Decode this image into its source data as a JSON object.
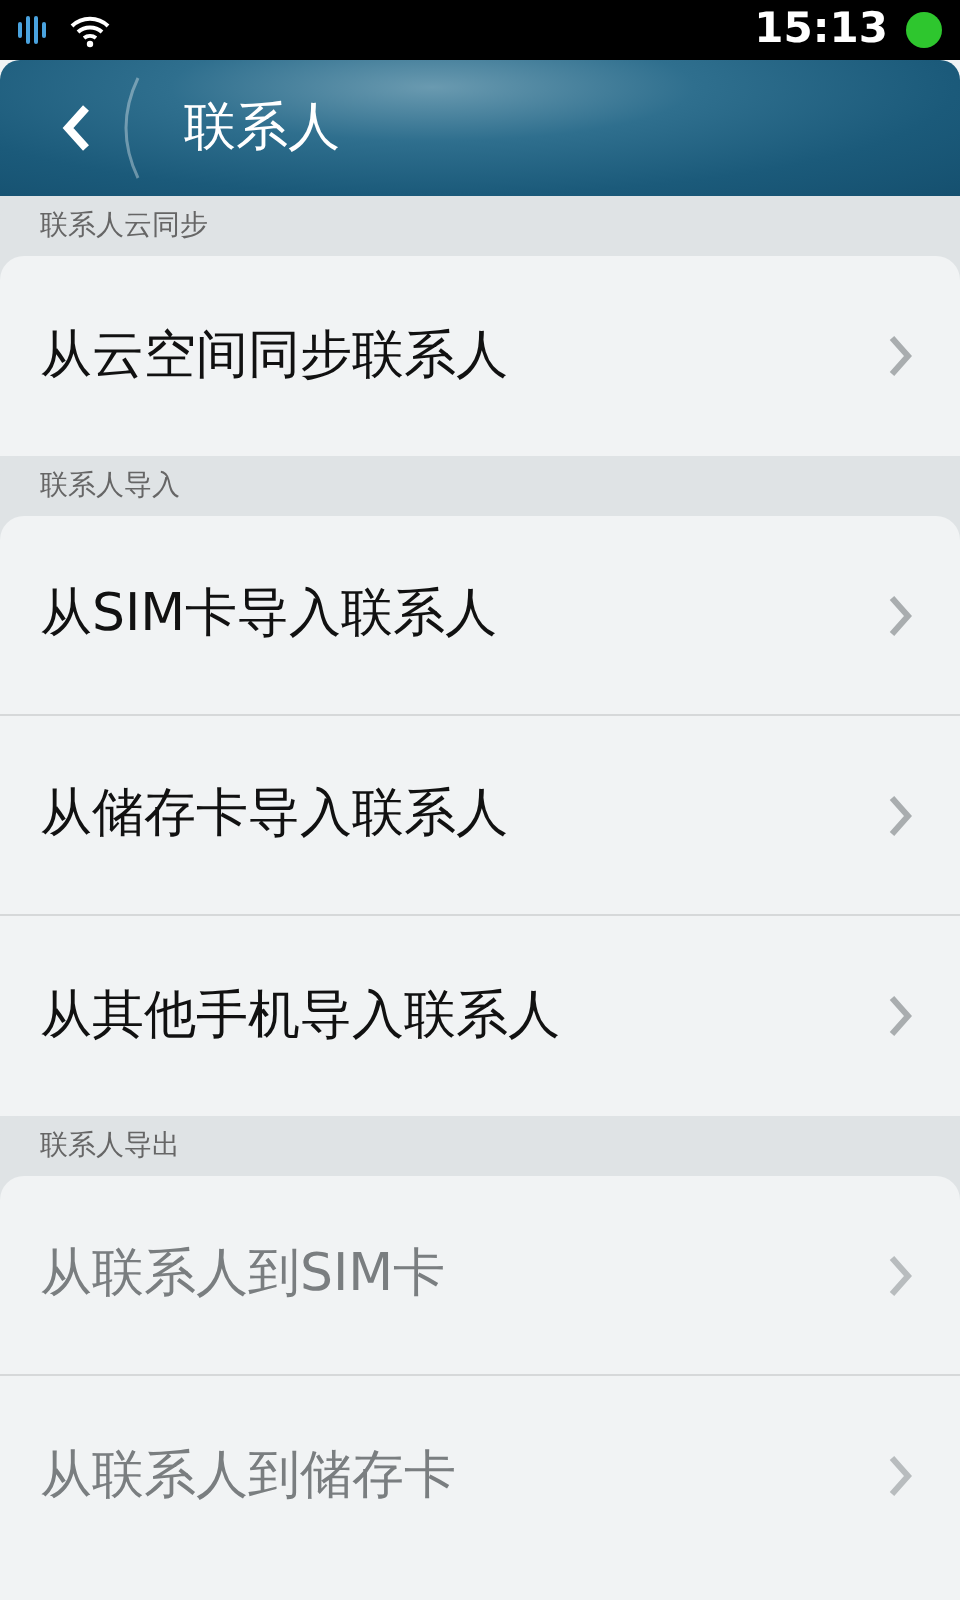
{
  "status_bar": {
    "time": "15:13"
  },
  "header": {
    "title": "联系人"
  },
  "sections": [
    {
      "title": "联系人云同步",
      "items": [
        {
          "label": "从云空间同步联系人",
          "disabled": false
        }
      ]
    },
    {
      "title": "联系人导入",
      "items": [
        {
          "label": "从SIM卡导入联系人",
          "disabled": false
        },
        {
          "label": "从储存卡导入联系人",
          "disabled": false
        },
        {
          "label": "从其他手机导入联系人",
          "disabled": false
        }
      ]
    },
    {
      "title": "联系人导出",
      "items": [
        {
          "label": "从联系人到SIM卡",
          "disabled": true
        },
        {
          "label": "从联系人到储存卡",
          "disabled": true
        }
      ]
    }
  ]
}
